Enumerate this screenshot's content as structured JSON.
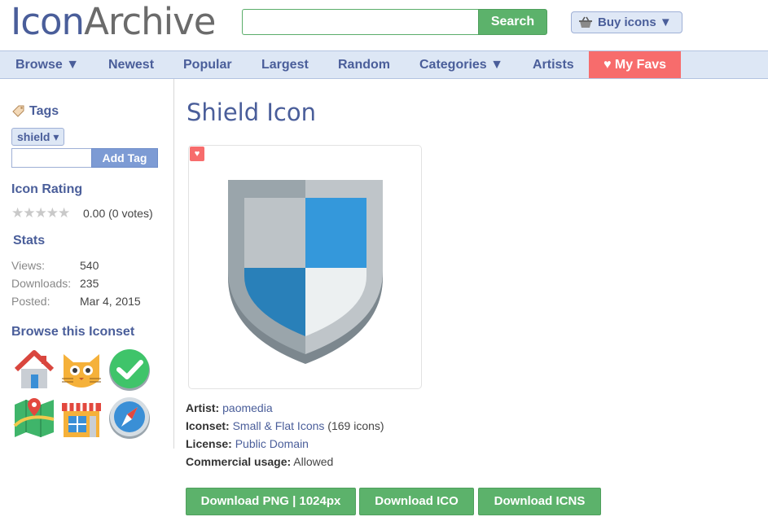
{
  "logo": {
    "part1": "Icon",
    "part2": "Archive"
  },
  "search": {
    "value": "",
    "button_label": "Search"
  },
  "buy_icons": {
    "label": "Buy icons ▼"
  },
  "nav": {
    "browse": "Browse ▼",
    "newest": "Newest",
    "popular": "Popular",
    "largest": "Largest",
    "random": "Random",
    "categories": "Categories ▼",
    "artists": "Artists",
    "my_favs": "♥ My Favs"
  },
  "sidebar": {
    "tags_heading": "Tags",
    "tag_pill": "shield ▾",
    "tag_input_value": "",
    "add_tag_label": "Add Tag",
    "rating_heading": "Icon Rating",
    "stars": "★★★★★",
    "rating_value": "0.00 (0 votes)",
    "stats_heading": "Stats",
    "stats": {
      "views_label": "Views:",
      "views_value": "540",
      "downloads_label": "Downloads:",
      "downloads_value": "235",
      "posted_label": "Posted:",
      "posted_value": "Mar 4, 2015"
    },
    "browse_heading": "Browse this Iconset",
    "thumbnails": [
      "home-icon",
      "cat-icon",
      "checkmark-icon",
      "map-icon",
      "shop-icon",
      "compass-icon"
    ]
  },
  "main": {
    "title": "Shield Icon",
    "icon_name": "shield-icon",
    "artist_label": "Artist:",
    "artist_value": "paomedia",
    "iconset_label": "Iconset:",
    "iconset_value": "Small & Flat Icons",
    "iconset_count": "(169 icons)",
    "license_label": "License:",
    "license_value": "Public Domain",
    "commercial_label": "Commercial usage:",
    "commercial_value": "Allowed",
    "download_png": "Download PNG | 1024px",
    "download_ico": "Download ICO",
    "download_icns": "Download ICNS"
  },
  "colors": {
    "brand_blue": "#4a5e9a",
    "green": "#5cb26b",
    "fav_red": "#f76c6c",
    "nav_bg": "#dde7f5"
  }
}
